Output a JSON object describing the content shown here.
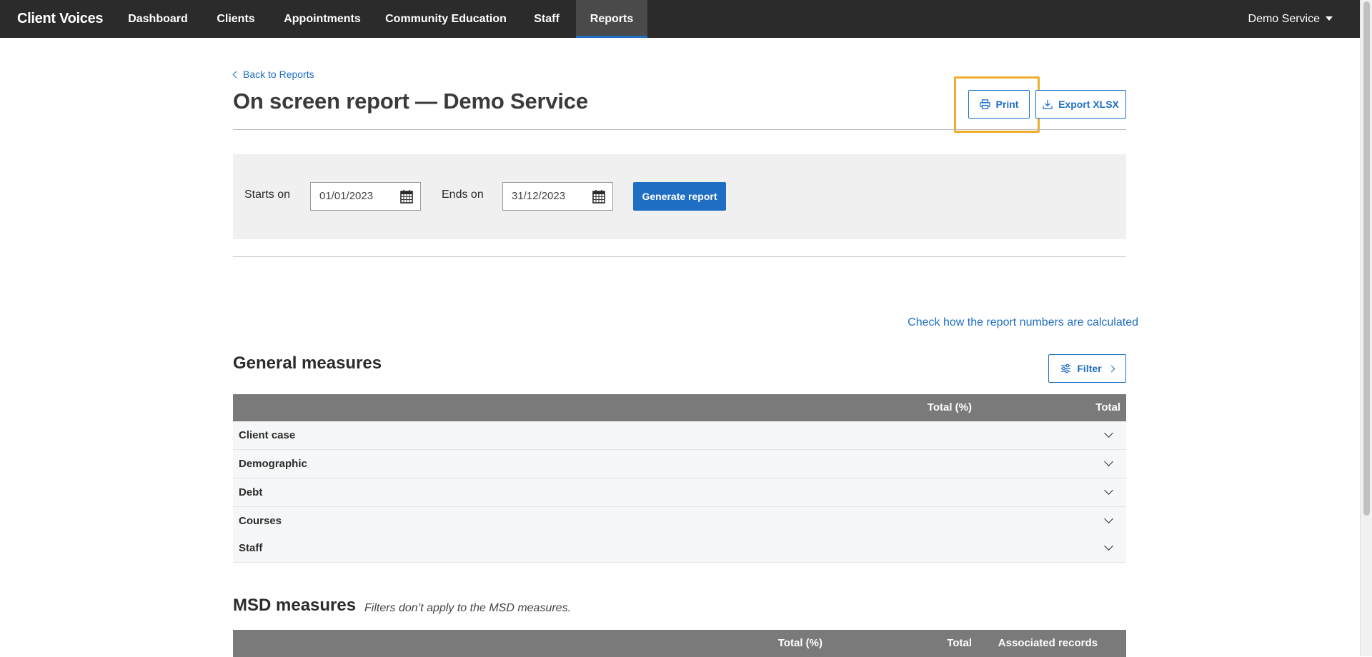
{
  "nav": {
    "brand": "Client Voices",
    "items": [
      {
        "label": "Dashboard"
      },
      {
        "label": "Clients"
      },
      {
        "label": "Appointments"
      },
      {
        "label": "Community Education"
      },
      {
        "label": "Staff"
      },
      {
        "label": "Reports",
        "active": true
      }
    ],
    "service_menu": "Demo Service"
  },
  "page": {
    "back_link": "Back to Reports",
    "title": "On screen report — Demo Service",
    "print_label": "Print",
    "export_label": "Export XLSX"
  },
  "filters": {
    "starts_label": "Starts on",
    "starts_value": "01/01/2023",
    "ends_label": "Ends on",
    "ends_value": "31/12/2023",
    "generate_label": "Generate report"
  },
  "calc_link": "Check how the report numbers are calculated",
  "general": {
    "title": "General measures",
    "filter_label": "Filter",
    "headers": {
      "total_pct": "Total (%)",
      "total": "Total"
    },
    "rows": [
      "Client case",
      "Demographic",
      "Debt",
      "Courses",
      "Staff"
    ]
  },
  "msd": {
    "title": "MSD measures",
    "note": "Filters don’t apply to the MSD measures.",
    "headers": {
      "total_pct": "Total (%)",
      "total": "Total",
      "associated": "Associated records"
    }
  },
  "colors": {
    "nav_bg": "#2b2b2b",
    "accent": "#1e6ec4",
    "highlight": "#f0ad2d",
    "table_head": "#7a7a7a"
  }
}
